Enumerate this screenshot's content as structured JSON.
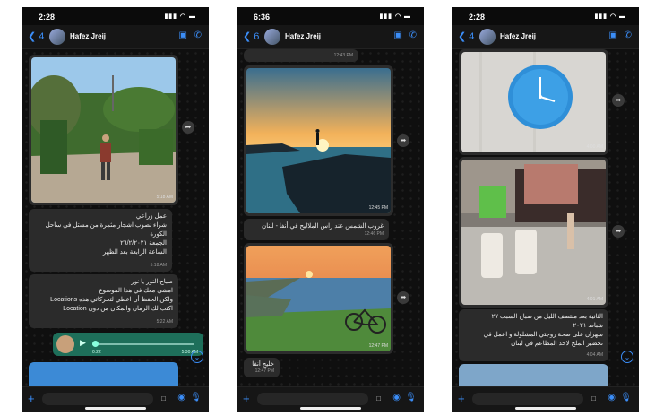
{
  "chat": {
    "contact_name": "Hafez Jreij",
    "colors": {
      "accent": "#3b8df7",
      "bubble": "#2c2c2c",
      "voice_bubble": "#1e6f5a"
    }
  },
  "screen1": {
    "status_time": "2:28",
    "back_count": "4",
    "photo_time": "5:18 AM",
    "msg1": {
      "lines": [
        "عمل زراعي",
        "شراء نصوب اشجار مثمرة من مشتل في ساحل",
        "الكورة",
        "الجمعة ٢٦/٢/٢٠٢١",
        "الساعة الرابعة بعد الظهر"
      ],
      "time": "5:18 AM"
    },
    "msg2": {
      "lines": [
        "صباح النور يا نور",
        "امشي معك في هذا الموضوع",
        "ولكن الحفظ أن اعطي لتحركاتي هذه Locations",
        "اكتب لك الزمان والمكان من دون Location"
      ],
      "time": "5:22 AM"
    },
    "voice": {
      "duration": "0:22",
      "time": "5:30 AM"
    }
  },
  "screen2": {
    "status_time": "6:36",
    "back_count": "6",
    "top_time": "12:43 PM",
    "photo1_time": "12:45 PM",
    "msg1": {
      "text": "غروب الشمس عند راس الملاليح في أنفا - لبنان",
      "time": "12:46 PM"
    },
    "photo2_time": "12:47 PM",
    "msg2": {
      "text": "خليج أنفا",
      "time": "12:47 PM"
    }
  },
  "screen3": {
    "status_time": "2:28",
    "back_count": "4",
    "photo1_time": "4:00 AM",
    "photo2_time": "4:01 AM",
    "msg1": {
      "lines": [
        "الثانية بعد منتصف الليل من صباح السبت ٢٧",
        "شباط ٢٠٢١",
        "سهران على صحة زوجتي المشلولة و اعمل في",
        "تحضير الملح لاحد المطاعم في لبنان"
      ],
      "time": "4:04 AM"
    }
  },
  "icons": [
    "back-chevron-icon",
    "video-call-icon",
    "phone-call-icon",
    "forward-icon",
    "play-icon",
    "plus-icon",
    "sticker-icon",
    "camera-icon",
    "microphone-icon",
    "scroll-down-icon"
  ]
}
